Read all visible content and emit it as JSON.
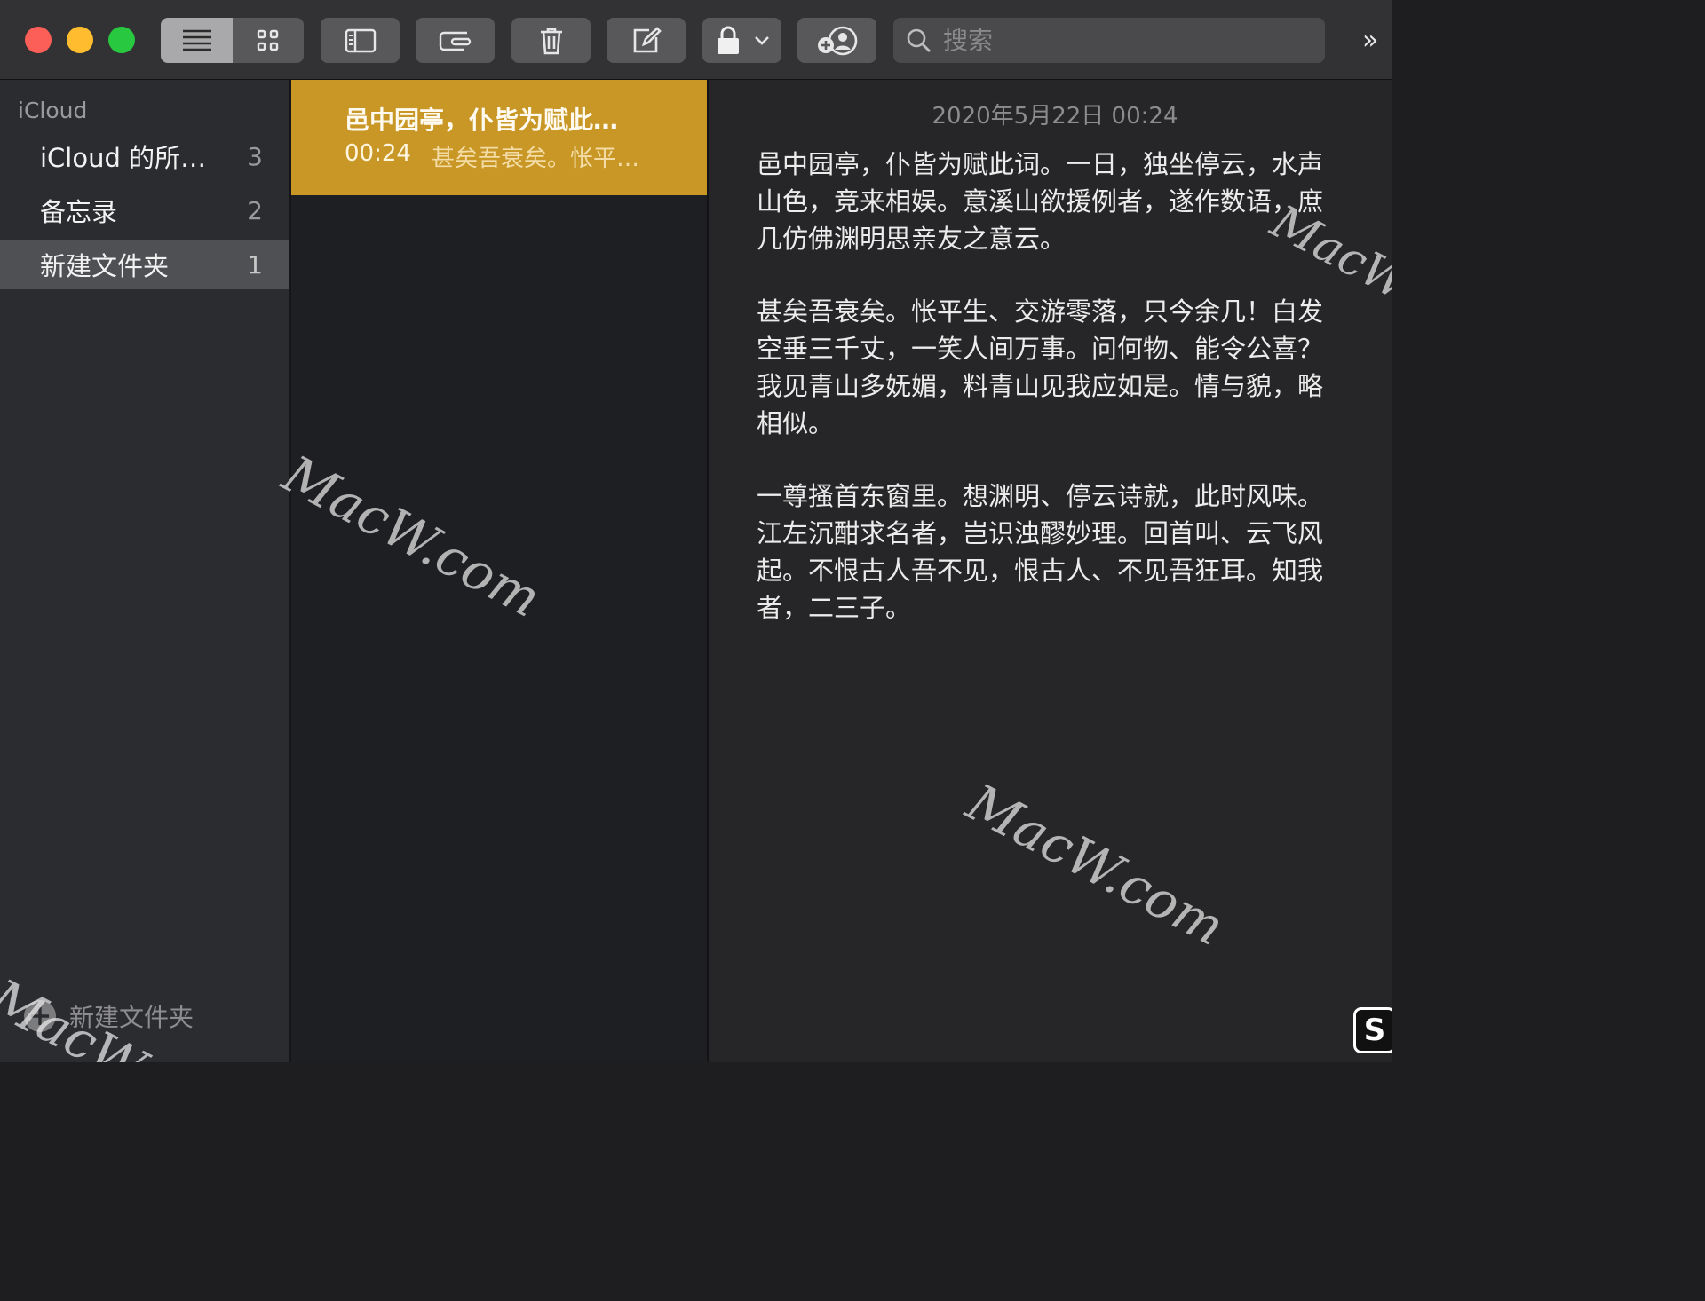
{
  "toolbar": {
    "search_placeholder": "搜索",
    "overflow_label": "»",
    "icons": [
      "list-view-icon",
      "gallery-view-icon",
      "sidebar-toggle-icon",
      "attachments-icon",
      "trash-icon",
      "compose-icon",
      "lock-icon",
      "add-people-icon",
      "search-icon"
    ]
  },
  "sidebar": {
    "section_title": "iCloud",
    "folders": [
      {
        "label": "iCloud 的所…",
        "count": "3"
      },
      {
        "label": "备忘录",
        "count": "2"
      },
      {
        "label": "新建文件夹",
        "count": "1",
        "selected": true
      }
    ],
    "new_folder_label": "新建文件夹"
  },
  "notelist": {
    "items": [
      {
        "title": "邑中园亭，仆皆为赋此…",
        "time": "00:24",
        "snippet": "甚矣吾衰矣。怅平…"
      }
    ]
  },
  "editor": {
    "date": "2020年5月22日 00:24",
    "paragraphs": [
      "邑中园亭，仆皆为赋此词。一日，独坐停云，水声山色，竞来相娱。意溪山欲援例者，遂作数语，庶几仿佛渊明思亲友之意云。",
      "甚矣吾衰矣。怅平生、交游零落，只今余几！白发空垂三千丈，一笑人间万事。问何物、能令公喜？我见青山多妩媚，料青山见我应如是。情与貌，略相似。",
      "一尊搔首东窗里。想渊明、停云诗就，此时风味。江左沉酣求名者，岂识浊醪妙理。回首叫、云飞风起。不恨古人吾不见，恨古人、不见吾狂耳。知我者，二三子。"
    ]
  },
  "badge": {
    "label": "S"
  },
  "watermark": {
    "text": "MacW.com"
  },
  "colors": {
    "accent": "#c99726",
    "close": "#fc5f57",
    "minimize": "#febc2e",
    "maximize": "#28c840"
  }
}
